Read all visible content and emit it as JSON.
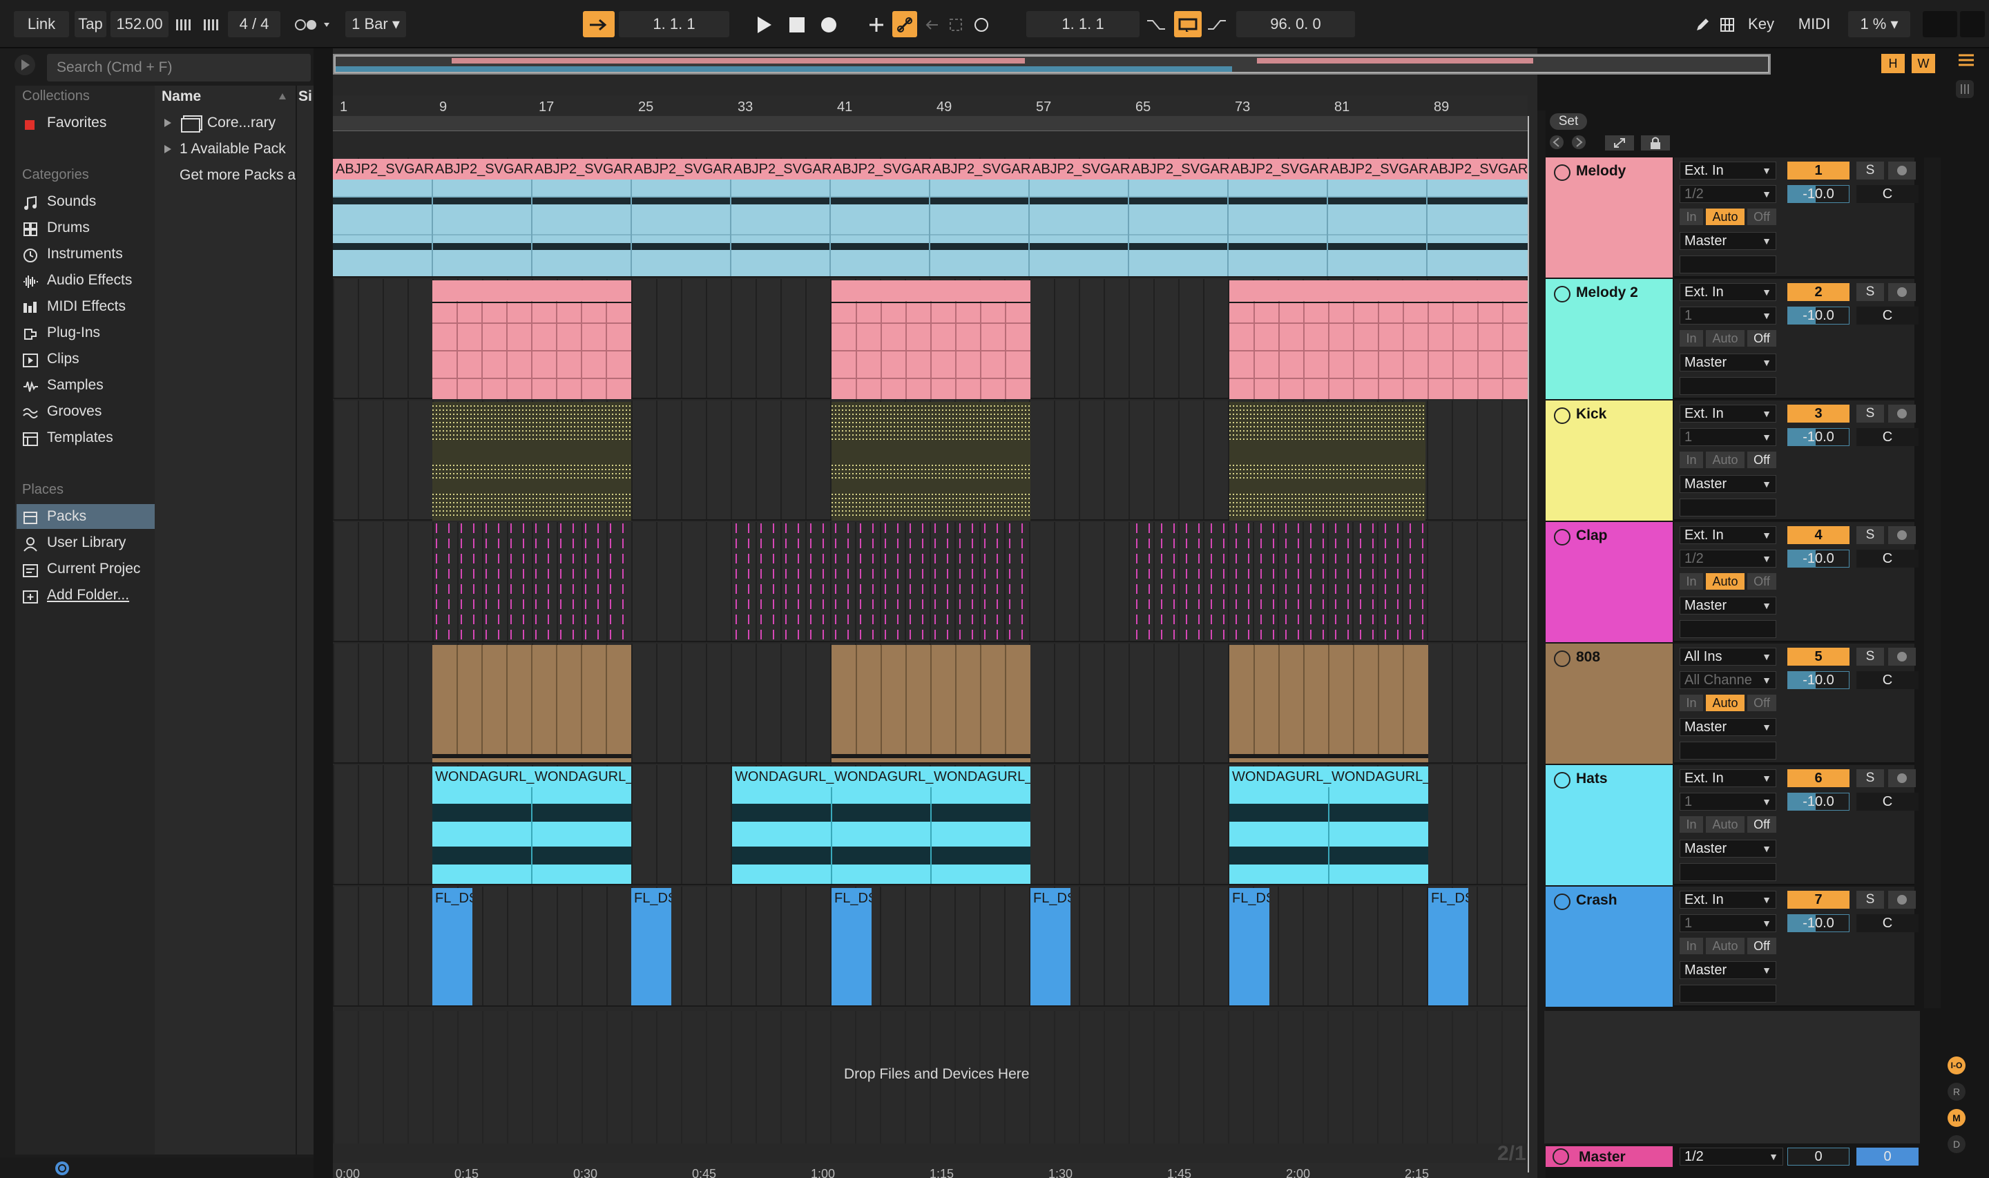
{
  "topbar": {
    "link": "Link",
    "tap": "Tap",
    "tempo": "152.00",
    "signature": "4 / 4",
    "quant": "1 Bar",
    "arrangement_pos": "1.   1.   1",
    "loop_start": "1.   1.   1",
    "loop_length": "96.   0.   0",
    "key": "Key",
    "midi": "MIDI",
    "cpu": "1 %",
    "overview_h": "H",
    "overview_w": "W"
  },
  "browser": {
    "search_placeholder": "Search (Cmd + F)",
    "collections_title": "Collections",
    "favorites": "Favorites",
    "categories_title": "Categories",
    "categories": [
      "Sounds",
      "Drums",
      "Instruments",
      "Audio Effects",
      "MIDI Effects",
      "Plug-Ins",
      "Clips",
      "Samples",
      "Grooves",
      "Templates"
    ],
    "places_title": "Places",
    "places": [
      "Packs",
      "User Library",
      "Current Projec",
      "Add Folder..."
    ],
    "col_name": "Name",
    "col_size": "Si",
    "items": [
      "Core...rary",
      "1 Available Pack",
      "Get more Packs a"
    ]
  },
  "ruler": {
    "bars": [
      "1",
      "9",
      "17",
      "25",
      "33",
      "41",
      "49",
      "57",
      "65",
      "73",
      "81",
      "89"
    ],
    "times": [
      "0:00",
      "0:15",
      "0:30",
      "0:45",
      "1:00",
      "1:15",
      "1:30",
      "1:45",
      "2:00",
      "2:15"
    ],
    "set_label": "Set",
    "zoom_label": "2/1"
  },
  "clips": {
    "melody": "ABJP2_SVGAR",
    "hats": "WONDAGURL_",
    "crash": "FL_DS"
  },
  "drop_text": "Drop Files and Devices Here",
  "tracks": [
    {
      "name": "Melody",
      "color": "#f09aa6",
      "input": "Ext. In",
      "channel": "1/2",
      "number": "1",
      "volume": "-10.0",
      "pan": "C",
      "output": "Master",
      "solo": "S",
      "mon_auto_active": true
    },
    {
      "name": "Melody 2",
      "color": "#7ff2e0",
      "input": "Ext. In",
      "channel": "1",
      "number": "2",
      "volume": "-10.0",
      "pan": "C",
      "output": "Master",
      "solo": "S",
      "mon_auto_active": false
    },
    {
      "name": "Kick",
      "color": "#f4ef89",
      "input": "Ext. In",
      "channel": "1",
      "number": "3",
      "volume": "-10.0",
      "pan": "C",
      "output": "Master",
      "solo": "S",
      "mon_auto_active": false
    },
    {
      "name": "Clap",
      "color": "#e54fc6",
      "input": "Ext. In",
      "channel": "1/2",
      "number": "4",
      "volume": "-10.0",
      "pan": "C",
      "output": "Master",
      "solo": "S",
      "mon_auto_active": true
    },
    {
      "name": "808",
      "color": "#9c7a55",
      "input": "All Ins",
      "channel": "All Channe",
      "number": "5",
      "volume": "-10.0",
      "pan": "C",
      "output": "Master",
      "solo": "S",
      "mon_auto_active": true
    },
    {
      "name": "Hats",
      "color": "#6ee3f5",
      "input": "Ext. In",
      "channel": "1",
      "number": "6",
      "volume": "-10.0",
      "pan": "C",
      "output": "Master",
      "solo": "S",
      "mon_auto_active": false
    },
    {
      "name": "Crash",
      "color": "#48a0e6",
      "input": "Ext. In",
      "channel": "1",
      "number": "7",
      "volume": "-10.0",
      "pan": "C",
      "output": "Master",
      "solo": "S",
      "mon_auto_active": false
    }
  ],
  "monitor": {
    "in": "In",
    "auto": "Auto",
    "off": "Off"
  },
  "master": {
    "name": "Master",
    "color": "#e54f9c",
    "channel": "1/2",
    "volume": "0",
    "pan": "0"
  },
  "side_letters": [
    "I-O",
    "R",
    "M",
    "D"
  ]
}
